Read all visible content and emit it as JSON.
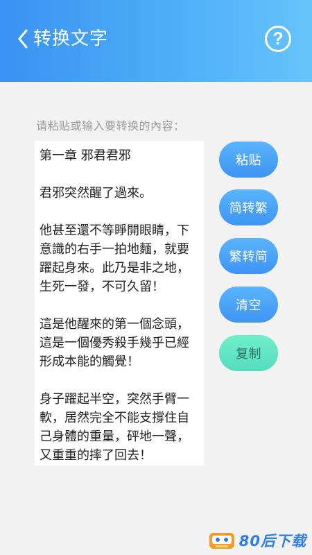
{
  "header": {
    "title": "转换文字",
    "help_symbol": "?"
  },
  "input": {
    "hint": "请粘贴或输入要转换的內容：",
    "text": "第一章 邪君君邪\n\n君邪突然醒了過來。\n\n他甚至還不等睜開眼睛，下意識的右手一拍地麵，就要躍起身來。此乃是非之地，生死一發，不可久留！\n\n這是他醒來的第一個念頭，這是一個優秀殺手幾乎已經形成本能的觸覺！\n\n身子躍起半空，突然手臂一軟，居然完全不能支撐住自己身體的重量，砰地一聲，又重重的摔了回去！"
  },
  "buttons": {
    "paste": "粘贴",
    "to_traditional": "简转繁",
    "to_simplified": "繁转简",
    "clear": "清空",
    "copy": "复制"
  },
  "watermark": {
    "text": "80后下载"
  },
  "colors": {
    "header_start": "#3a92f2",
    "header_end": "#67c3fb",
    "button_blue": "#4aa4f8",
    "button_teal": "#62e6c4"
  }
}
